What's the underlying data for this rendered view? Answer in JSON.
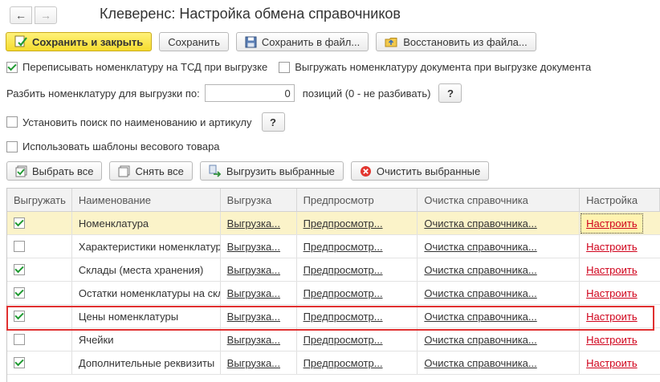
{
  "title": "Клеверенс: Настройка обмена справочников",
  "nav": {
    "back_glyph": "←",
    "forward_glyph": "→"
  },
  "toolbar": {
    "save_close": "Сохранить и закрыть",
    "save": "Сохранить",
    "save_file": "Сохранить в файл...",
    "restore_file": "Восстановить из файла..."
  },
  "options": {
    "overwrite_label": "Переписывать номенклатуру на ТСД при выгрузке",
    "overwrite_checked": true,
    "export_doc_label": "Выгружать номенклатуру документа при выгрузке документа",
    "export_doc_checked": false,
    "split_label": "Разбить номенклатуру для выгрузки по:",
    "split_value": "0",
    "split_suffix": "позиций (0 - не разбивать)",
    "help_glyph": "?",
    "search_label": "Установить поиск по наименованию и артикулу",
    "search_checked": false,
    "weight_label": "Использовать шаблоны весового товара",
    "weight_checked": false
  },
  "actions": {
    "select_all": "Выбрать все",
    "deselect_all": "Снять все",
    "export_selected": "Выгрузить выбранные",
    "clear_selected": "Очистить выбранные"
  },
  "table": {
    "headers": [
      "Выгружать",
      "Наименование",
      "Выгрузка",
      "Предпросмотр",
      "Очистка справочника",
      "Настройка"
    ],
    "rows": [
      {
        "checked": true,
        "name": "Номенклатура",
        "export": "Выгрузка...",
        "preview": "Предпросмотр...",
        "clear": "Очистка справочника...",
        "settings": "Настроить"
      },
      {
        "checked": false,
        "name": "Характеристики номенклатуры",
        "export": "Выгрузка...",
        "preview": "Предпросмотр...",
        "clear": "Очистка справочника...",
        "settings": "Настроить"
      },
      {
        "checked": true,
        "name": "Склады (места хранения)",
        "export": "Выгрузка...",
        "preview": "Предпросмотр...",
        "clear": "Очистка справочника...",
        "settings": "Настроить"
      },
      {
        "checked": true,
        "name": "Остатки номенклатуры на складах",
        "export": "Выгрузка...",
        "preview": "Предпросмотр...",
        "clear": "Очистка справочника...",
        "settings": "Настроить"
      },
      {
        "checked": true,
        "name": "Цены номенклатуры",
        "export": "Выгрузка...",
        "preview": "Предпросмотр...",
        "clear": "Очистка справочника...",
        "settings": "Настроить"
      },
      {
        "checked": false,
        "name": "Ячейки",
        "export": "Выгрузка...",
        "preview": "Предпросмотр...",
        "clear": "Очистка справочника...",
        "settings": "Настроить"
      },
      {
        "checked": true,
        "name": "Дополнительные реквизиты",
        "export": "Выгрузка...",
        "preview": "Предпросмотр...",
        "clear": "Очистка справочника...",
        "settings": "Настроить"
      }
    ]
  },
  "colors": {
    "accent_yellow": "#f5dc2e",
    "check_green": "#1f9a31",
    "link_red": "#d0021b",
    "highlight_red": "#e03030"
  },
  "icons": [
    "save-check-icon",
    "floppy-disk-icon",
    "folder-restore-icon",
    "select-all-icon",
    "deselect-all-icon",
    "export-arrow-icon",
    "clear-red-icon"
  ]
}
